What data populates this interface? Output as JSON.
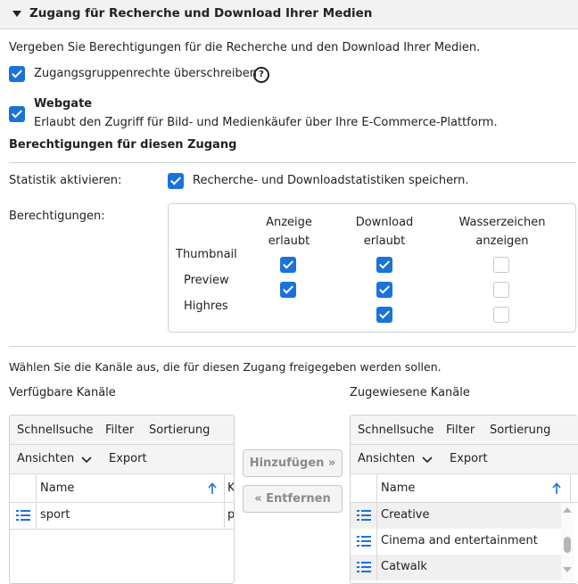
{
  "section": {
    "title": "Zugang für Recherche und Download Ihrer Medien"
  },
  "intro": "Vergeben Sie Berechtigungen für die Recherche und den Download Ihrer Medien.",
  "override": {
    "label": "Zugangsgruppenrechte überschreiben",
    "checked": true,
    "help_icon": "?"
  },
  "webgate": {
    "title": "Webgate",
    "description": "Erlaubt den Zugriff für Bild- und Medienkäufer über Ihre E-Commerce-Plattform.",
    "checked": true
  },
  "permissions_heading": "Berechtigungen für diesen Zugang",
  "statistics": {
    "label": "Statistik aktivieren:",
    "checkbox_label": "Recherche- und Downloadstatistiken speichern.",
    "checked": true
  },
  "permissions": {
    "label": "Berechtigungen:",
    "columns": [
      {
        "line1": "Anzeige",
        "line2": "erlaubt"
      },
      {
        "line1": "Download",
        "line2": "erlaubt"
      },
      {
        "line1": "Wasserzeichen",
        "line2": "anzeigen"
      }
    ],
    "rows": [
      {
        "name": "Thumbnail",
        "display": true,
        "download": true,
        "watermark": false
      },
      {
        "name": "Preview",
        "display": true,
        "download": true,
        "watermark": false
      },
      {
        "name": "Highres",
        "display": null,
        "download": true,
        "watermark": false
      }
    ]
  },
  "channels": {
    "instruction": "Wählen Sie die Kanäle aus, die für diesen Zugang freigegeben werden sollen.",
    "available": {
      "title": "Verfügbare Kanäle",
      "toolbar": {
        "quicksearch": "Schnellsuche",
        "filter": "Filter",
        "sort": "Sortierung",
        "views": "Ansichten",
        "export": "Export"
      },
      "columns": {
        "name": "Name",
        "second": "K"
      },
      "rows": [
        {
          "name": "sport",
          "second": "p"
        }
      ]
    },
    "add_button": "Hinzufügen »",
    "remove_button": "« Entfernen",
    "assigned": {
      "title": "Zugewiesene Kanäle",
      "toolbar": {
        "quicksearch": "Schnellsuche",
        "filter": "Filter",
        "sort": "Sortierung",
        "views": "Ansichten",
        "export": "Export"
      },
      "columns": {
        "name": "Name"
      },
      "rows": [
        {
          "name": "Creative"
        },
        {
          "name": "Cinema and entertainment"
        },
        {
          "name": "Catwalk"
        }
      ]
    }
  },
  "colors": {
    "accent": "#1a73d9",
    "header_bg": "#f2f2f2",
    "border": "#cfcfcf"
  }
}
